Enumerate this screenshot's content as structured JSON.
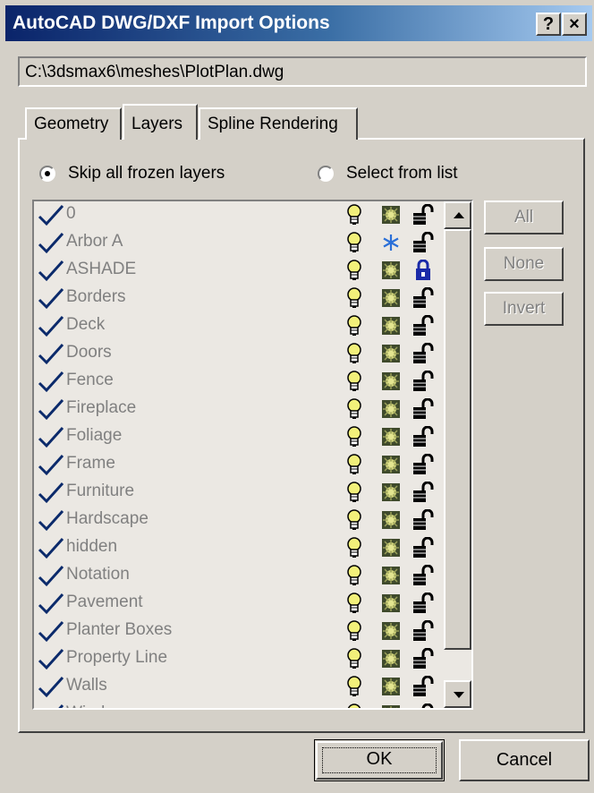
{
  "window": {
    "title": "AutoCAD DWG/DXF Import Options",
    "help_label": "?",
    "close_label": "×"
  },
  "file_path": "C:\\3dsmax6\\meshes\\PlotPlan.dwg",
  "tabs": [
    {
      "label": "Geometry",
      "active": false
    },
    {
      "label": "Layers",
      "active": true
    },
    {
      "label": "Spline Rendering",
      "active": false
    }
  ],
  "options": {
    "skip_frozen_label": "Skip all frozen layers",
    "select_list_label": "Select from list",
    "selected": "skip"
  },
  "layers": [
    {
      "name": "0",
      "checked": true,
      "frozen": false,
      "locked": false
    },
    {
      "name": "Arbor A",
      "checked": true,
      "frozen": true,
      "locked": false
    },
    {
      "name": "ASHADE",
      "checked": true,
      "frozen": false,
      "locked": true
    },
    {
      "name": "Borders",
      "checked": true,
      "frozen": false,
      "locked": false
    },
    {
      "name": "Deck",
      "checked": true,
      "frozen": false,
      "locked": false
    },
    {
      "name": "Doors",
      "checked": true,
      "frozen": false,
      "locked": false
    },
    {
      "name": "Fence",
      "checked": true,
      "frozen": false,
      "locked": false
    },
    {
      "name": "Fireplace",
      "checked": true,
      "frozen": false,
      "locked": false
    },
    {
      "name": "Foliage",
      "checked": true,
      "frozen": false,
      "locked": false
    },
    {
      "name": "Frame",
      "checked": true,
      "frozen": false,
      "locked": false
    },
    {
      "name": "Furniture",
      "checked": true,
      "frozen": false,
      "locked": false
    },
    {
      "name": "Hardscape",
      "checked": true,
      "frozen": false,
      "locked": false
    },
    {
      "name": "hidden",
      "checked": true,
      "frozen": false,
      "locked": false
    },
    {
      "name": "Notation",
      "checked": true,
      "frozen": false,
      "locked": false
    },
    {
      "name": "Pavement",
      "checked": true,
      "frozen": false,
      "locked": false
    },
    {
      "name": "Planter Boxes",
      "checked": true,
      "frozen": false,
      "locked": false
    },
    {
      "name": "Property Line",
      "checked": true,
      "frozen": false,
      "locked": false
    },
    {
      "name": "Walls",
      "checked": true,
      "frozen": false,
      "locked": false
    },
    {
      "name": "Windows",
      "checked": true,
      "frozen": false,
      "locked": false
    }
  ],
  "side_buttons": {
    "all": "All",
    "none": "None",
    "invert": "Invert"
  },
  "dialog_buttons": {
    "ok": "OK",
    "cancel": "Cancel"
  },
  "colors": {
    "title_start": "#0a246a",
    "title_end": "#a6caf0",
    "face": "#d4d0c8",
    "list_bg": "#ebe8e3",
    "check": "#0b2a6b",
    "disabled_text": "#808080",
    "lock_locked": "#1a2aa8",
    "snowflake": "#2a6fd8"
  }
}
